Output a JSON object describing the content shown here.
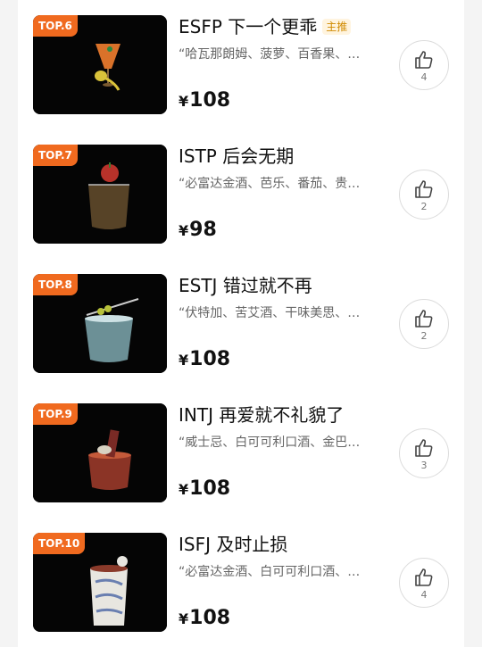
{
  "items": [
    {
      "rank": "TOP.6",
      "name": "ESFP 下一个更乖",
      "tag": "主推",
      "desc": "“哈瓦那朗姆、菠萝、百香果、…",
      "currency": "¥",
      "price": "108",
      "likes": "4"
    },
    {
      "rank": "TOP.7",
      "name": "ISTP 后会无期",
      "tag": "",
      "desc": "“必富达金酒、芭乐、番茄、贵…",
      "currency": "¥",
      "price": "98",
      "likes": "2"
    },
    {
      "rank": "TOP.8",
      "name": "ESTJ 错过就不再",
      "tag": "",
      "desc": "“伏特加、苦艾酒、干味美思、…",
      "currency": "¥",
      "price": "108",
      "likes": "2"
    },
    {
      "rank": "TOP.9",
      "name": "INTJ 再爱就不礼貌了",
      "tag": "",
      "desc": "“威士忌、白可可利口酒、金巴…",
      "currency": "¥",
      "price": "108",
      "likes": "3"
    },
    {
      "rank": "TOP.10",
      "name": "ISFJ 及时止损",
      "tag": "",
      "desc": "“必富达金酒、白可可利口酒、…",
      "currency": "¥",
      "price": "108",
      "likes": "4"
    }
  ],
  "colors": {
    "badge": "#f06a1f",
    "tag_text": "#d08a00",
    "tag_bg": "#fff4df"
  },
  "icons": {
    "like": "thumbs-up-icon"
  }
}
